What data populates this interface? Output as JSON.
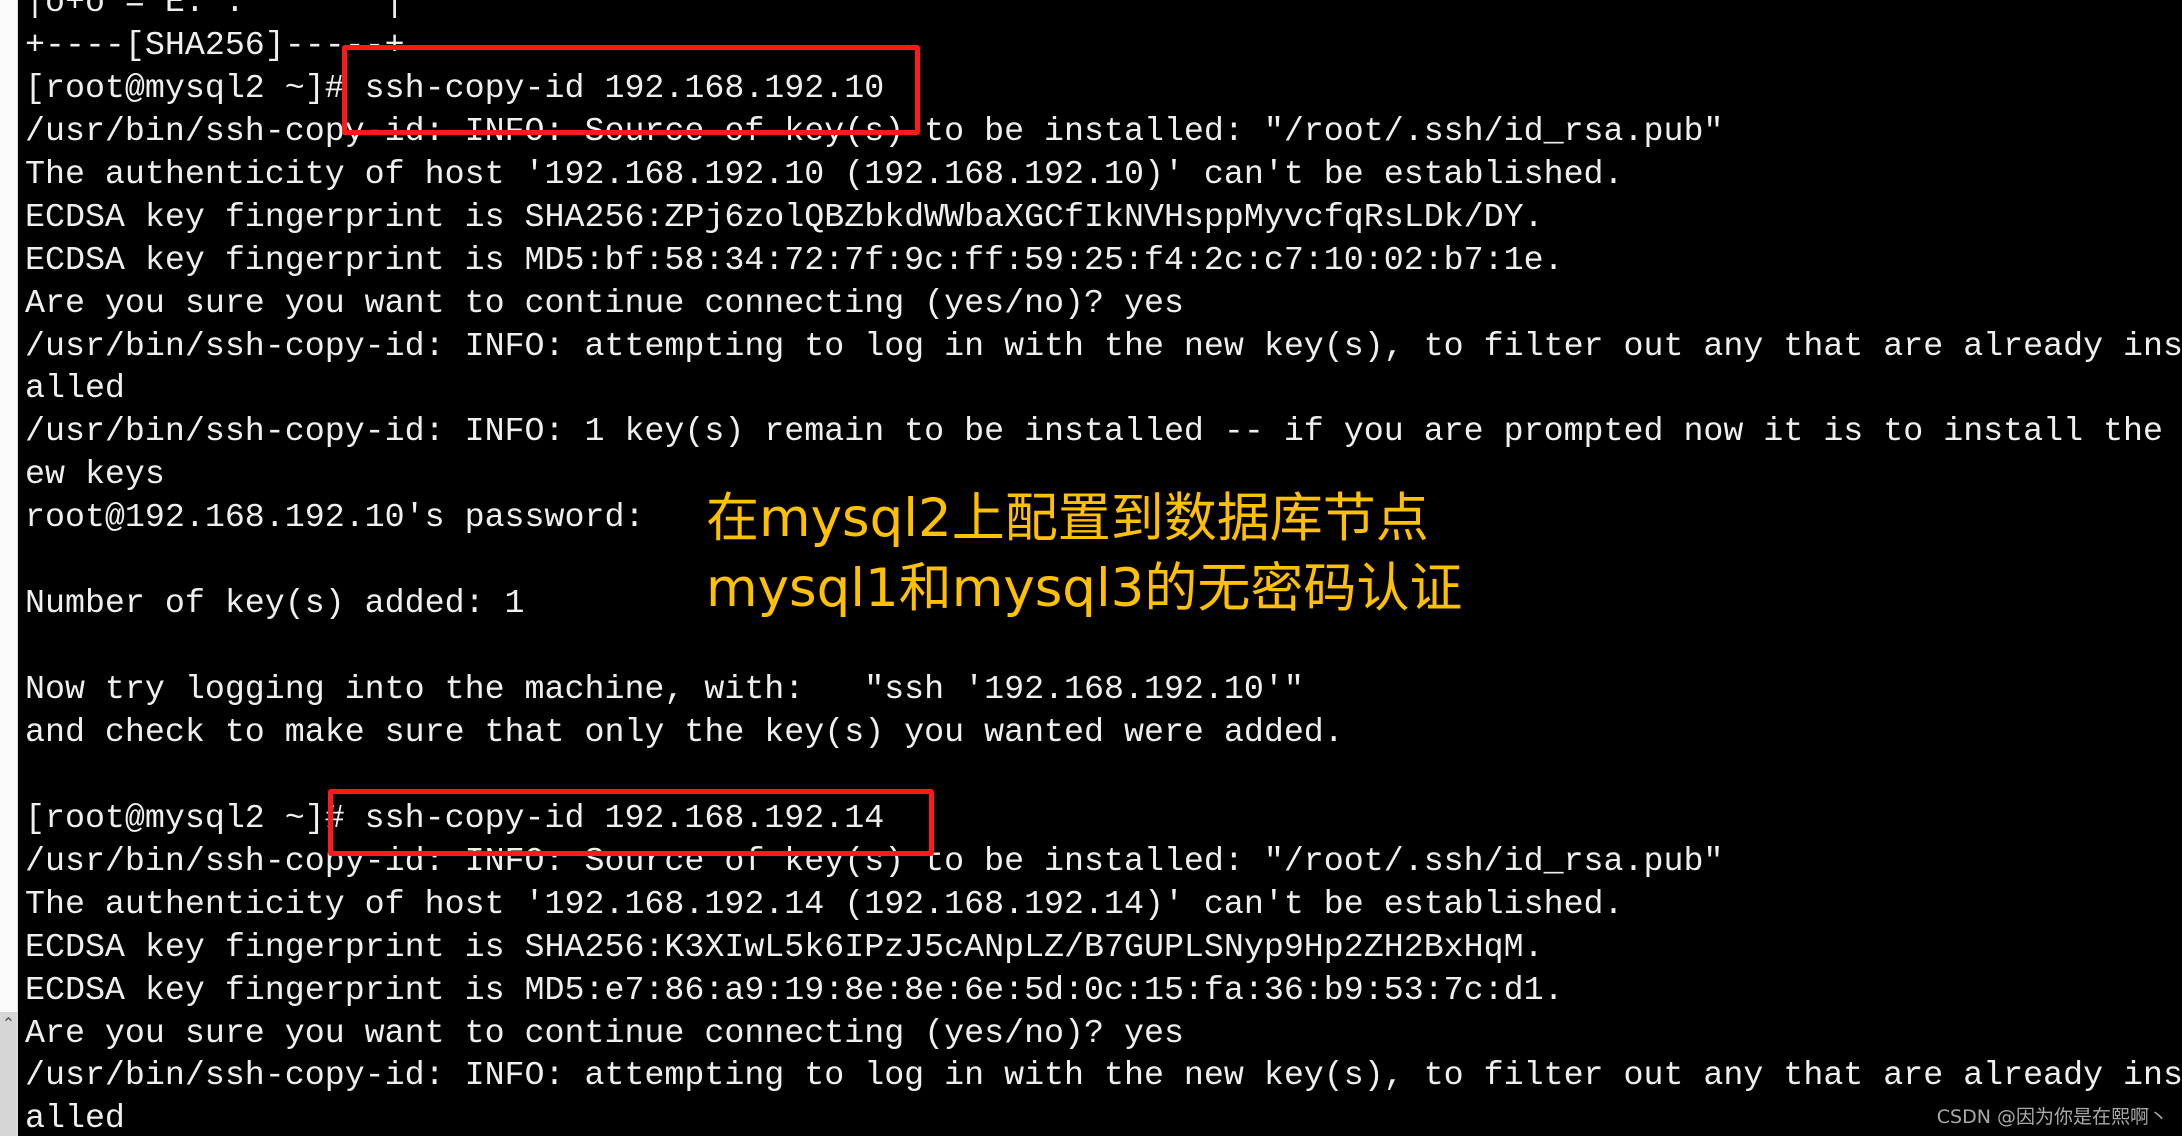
{
  "terminal": {
    "lines": [
      "|o+o =*E. .       |",
      "+----[SHA256]-----+",
      "[root@mysql2 ~]# ssh-copy-id 192.168.192.10",
      "/usr/bin/ssh-copy-id: INFO: Source of key(s) to be installed: \"/root/.ssh/id_rsa.pub\"",
      "The authenticity of host '192.168.192.10 (192.168.192.10)' can't be established.",
      "ECDSA key fingerprint is SHA256:ZPj6zolQBZbkdWWbaXGCfIkNVHsppMyvcfqRsLDk/DY.",
      "ECDSA key fingerprint is MD5:bf:58:34:72:7f:9c:ff:59:25:f4:2c:c7:10:02:b7:1e.",
      "Are you sure you want to continue connecting (yes/no)? yes",
      "/usr/bin/ssh-copy-id: INFO: attempting to log in with the new key(s), to filter out any that are already ins",
      "alled",
      "/usr/bin/ssh-copy-id: INFO: 1 key(s) remain to be installed -- if you are prompted now it is to install the n",
      "ew keys",
      "root@192.168.192.10's password:",
      "",
      "Number of key(s) added: 1",
      "",
      "Now try logging into the machine, with:   \"ssh '192.168.192.10'\"",
      "and check to make sure that only the key(s) you wanted were added.",
      "",
      "[root@mysql2 ~]# ssh-copy-id 192.168.192.14",
      "/usr/bin/ssh-copy-id: INFO: Source of key(s) to be installed: \"/root/.ssh/id_rsa.pub\"",
      "The authenticity of host '192.168.192.14 (192.168.192.14)' can't be established.",
      "ECDSA key fingerprint is SHA256:K3XIwL5k6IPzJ5cANpLZ/B7GUPLSNyp9Hp2ZH2BxHqM.",
      "ECDSA key fingerprint is MD5:e7:86:a9:19:8e:8e:6e:5d:0c:15:fa:36:b9:53:7c:d1.",
      "Are you sure you want to continue connecting (yes/no)? yes",
      "/usr/bin/ssh-copy-id: INFO: attempting to log in with the new key(s), to filter out any that are already ins",
      "alled"
    ]
  },
  "annotation": {
    "line1": "在mysql2上配置到数据库节点",
    "line2": "mysql1和mysql3的无密码认证"
  },
  "watermark": "CSDN @因为你是在熙啊丶",
  "colors": {
    "background": "#000000",
    "text": "#efefef",
    "highlight_box": "#ff1a1a",
    "annotation": "#ffc000"
  },
  "icons": {
    "scroll_up": "chevron-up-icon"
  }
}
